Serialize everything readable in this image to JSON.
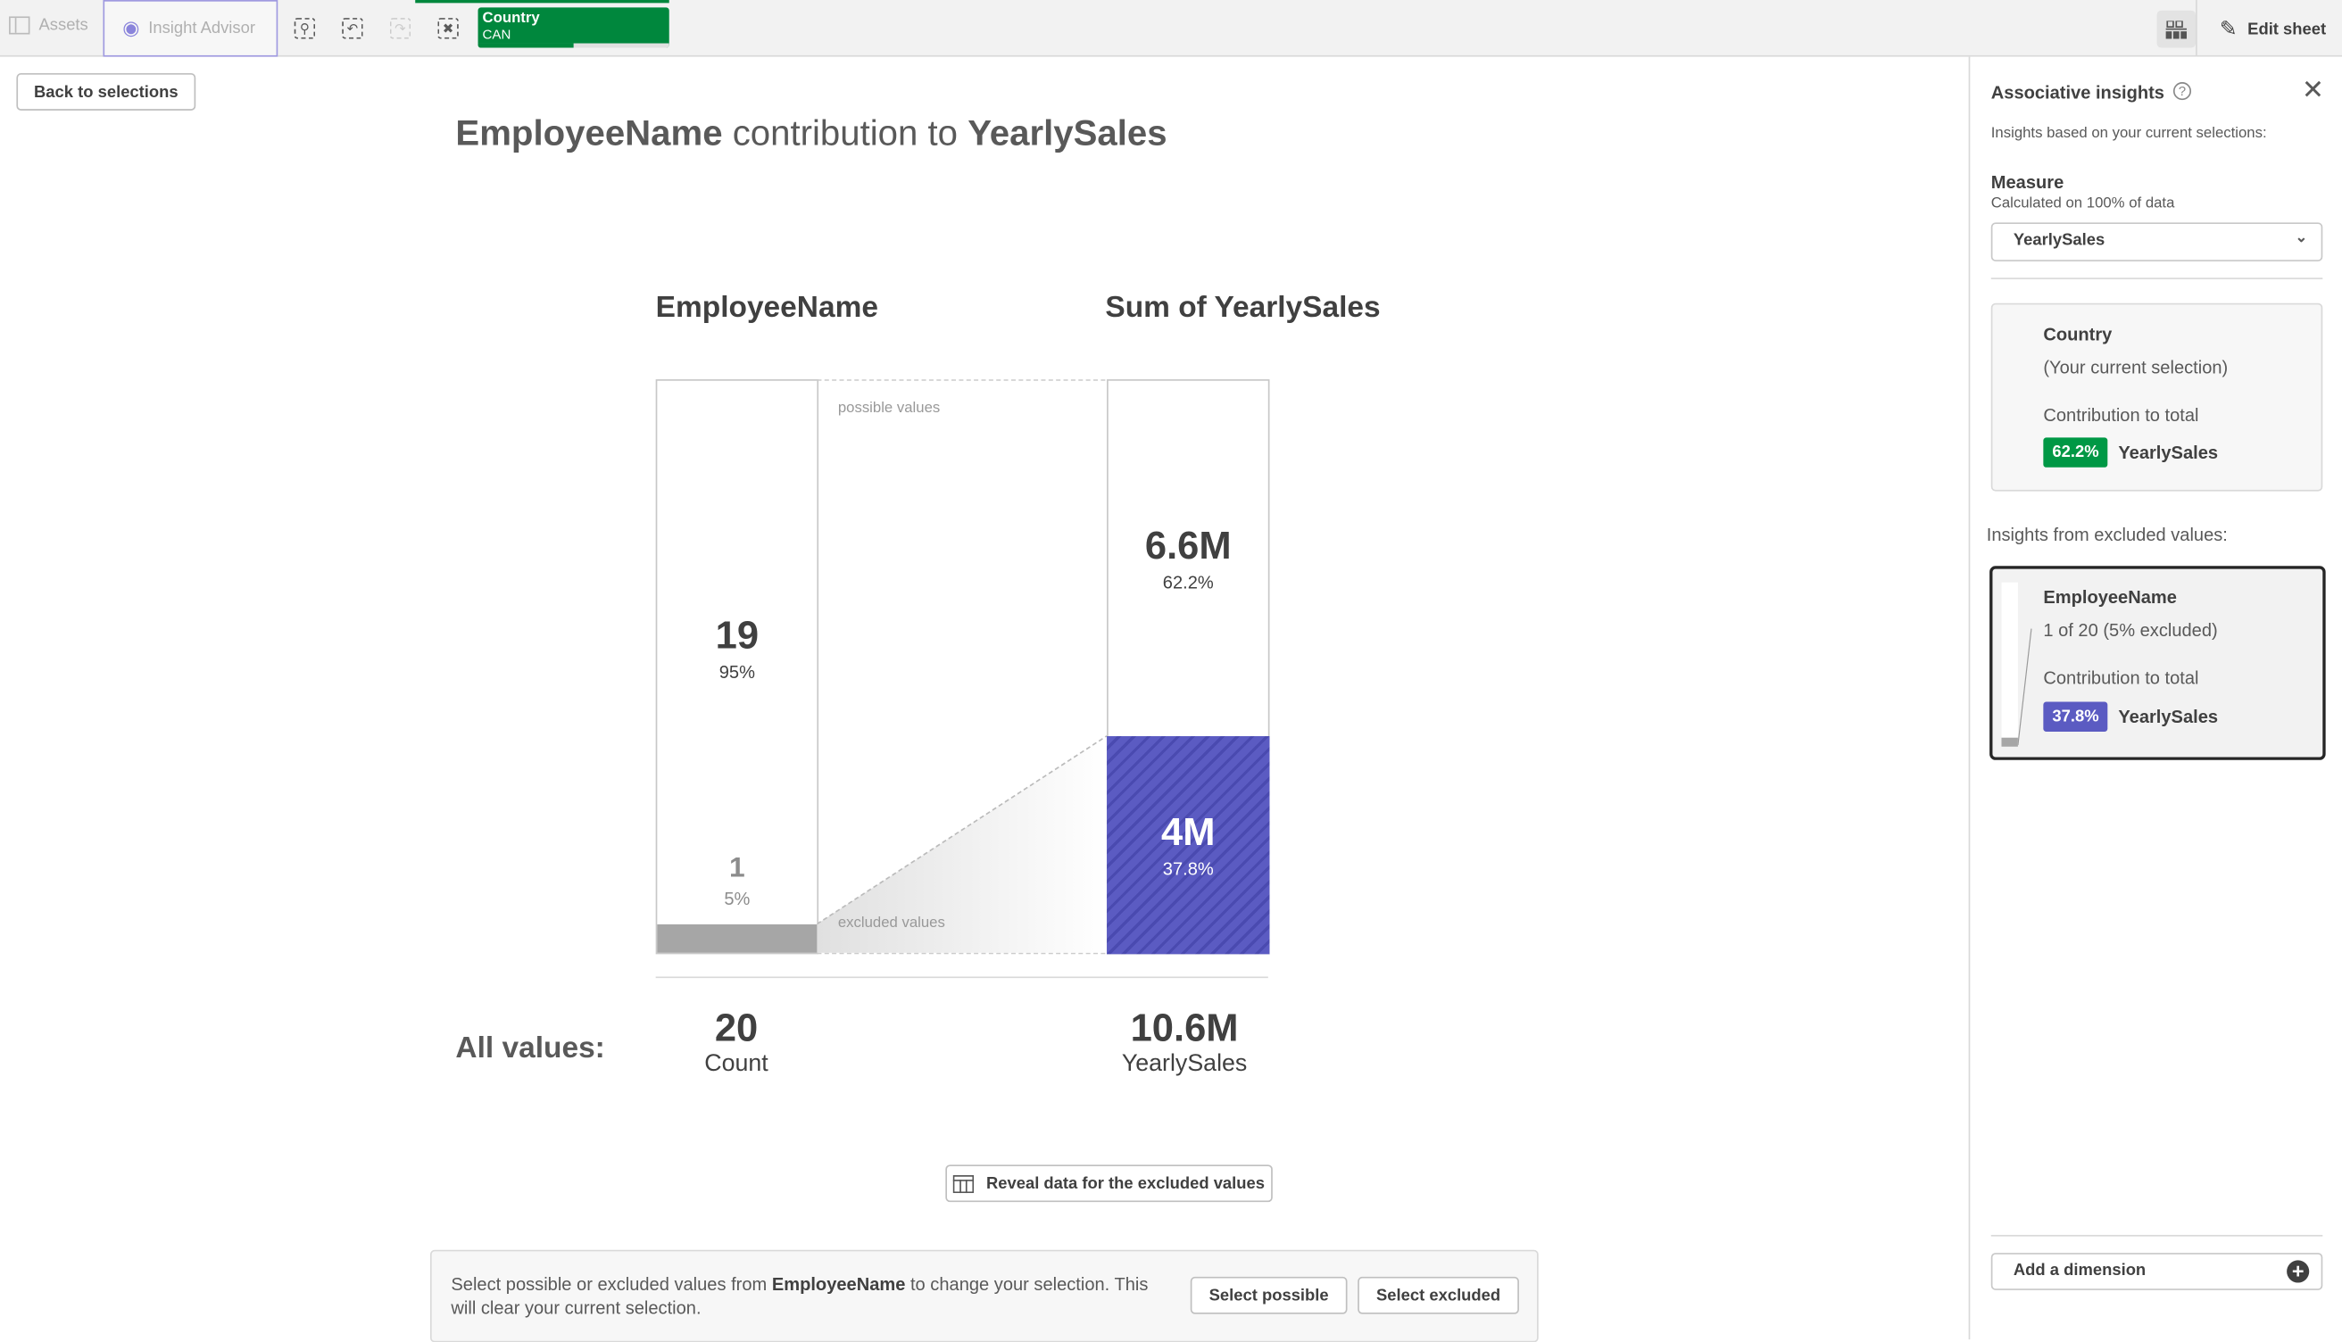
{
  "toolbar": {
    "assets_label": "Assets",
    "insight_advisor_label": "Insight Advisor",
    "selection_field": "Country",
    "selection_value": "CAN",
    "edit_sheet_label": "Edit sheet",
    "icons": [
      "smart-search-icon",
      "step-back-icon",
      "step-forward-icon",
      "clear-selections-icon",
      "grid-icon",
      "pencil-icon"
    ]
  },
  "main": {
    "back_label": "Back to selections",
    "title_dimension": "EmployeeName",
    "title_middle": " contribution to ",
    "title_measure": "YearlySales",
    "col_dimension": "EmployeeName",
    "col_measure": "Sum of YearlySales",
    "possible_label": "possible values",
    "excluded_label": "excluded values",
    "all_values_label": "All values:",
    "total_count": "20",
    "total_count_label": "Count",
    "total_sales": "10.6M",
    "total_sales_label": "YearlySales",
    "reveal_label": "Reveal data for the excluded values",
    "footer_text_1": "Select possible or excluded values from ",
    "footer_text_bold": "EmployeeName",
    "footer_text_2": " to change your selection. This will clear your current selection.",
    "select_possible_label": "Select possible",
    "select_excluded_label": "Select excluded"
  },
  "chart_data": {
    "type": "bar",
    "categories": [
      "EmployeeName",
      "Sum of YearlySales"
    ],
    "dimension": {
      "possible_value": "19",
      "possible_pct": "95%",
      "excluded_value": "1",
      "excluded_pct": "5%",
      "possible_fraction": 0.95
    },
    "measure": {
      "possible_value": "6.6M",
      "possible_pct": "62.2%",
      "excluded_value": "4M",
      "excluded_pct": "37.8%",
      "possible_fraction": 0.622
    },
    "colors": {
      "excluded_dimension": "#a6a6a6",
      "excluded_measure": "#5b5bc2"
    }
  },
  "panel": {
    "title": "Associative insights",
    "subtitle": "Insights based on your current selections:",
    "measure_label": "Measure",
    "measure_note": "Calculated on 100% of data",
    "measure_value": "YearlySales",
    "current_card": {
      "field": "Country",
      "note": "(Your current selection)",
      "contribution_label": "Contribution to total",
      "pct": "62.2%",
      "measure": "YearlySales",
      "color": "#009845"
    },
    "excluded_heading": "Insights from excluded values:",
    "excluded_card": {
      "field": "EmployeeName",
      "note": "1 of 20 (5% excluded)",
      "contribution_label": "Contribution to total",
      "pct": "37.8%",
      "measure": "YearlySales",
      "color": "#5b5bc2"
    },
    "add_dimension_label": "Add a dimension"
  }
}
